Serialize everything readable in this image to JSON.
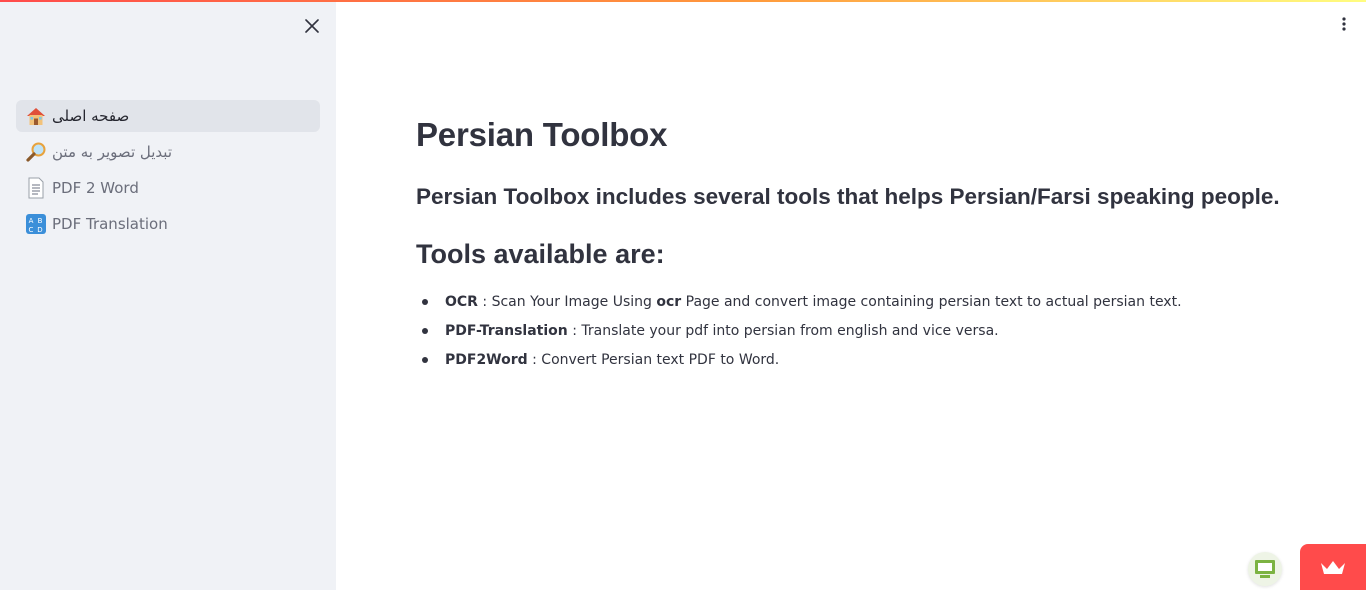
{
  "sidebar": {
    "items": [
      {
        "icon": "house-icon",
        "label": "صفحه اصلی",
        "active": true
      },
      {
        "icon": "magnifying-glass-icon",
        "label": "تبدیل تصویر به متن",
        "active": false
      },
      {
        "icon": "document-icon",
        "label": "PDF 2 Word",
        "active": false
      },
      {
        "icon": "abcd-input-icon",
        "label": "PDF Translation",
        "active": false
      }
    ]
  },
  "main": {
    "title": "Persian Toolbox",
    "subtitle": "Persian Toolbox includes several tools that helps Persian/Farsi speaking people.",
    "tools_heading": "Tools available are:",
    "tools": [
      {
        "name": "OCR",
        "desc_before": " : Scan Your Image Using ",
        "desc_bold": "ocr",
        "desc_after": " Page and convert image containing persian text to actual persian text."
      },
      {
        "name": "PDF-Translation",
        "desc_before": " : Translate your pdf into persian from english and vice versa.",
        "desc_bold": "",
        "desc_after": ""
      },
      {
        "name": "PDF2Word",
        "desc_before": " : Convert Persian text PDF to Word.",
        "desc_bold": "",
        "desc_after": ""
      }
    ]
  },
  "colors": {
    "sidebar_bg": "#f0f2f6",
    "accent": "#ff4b4b",
    "text": "#31333f"
  }
}
